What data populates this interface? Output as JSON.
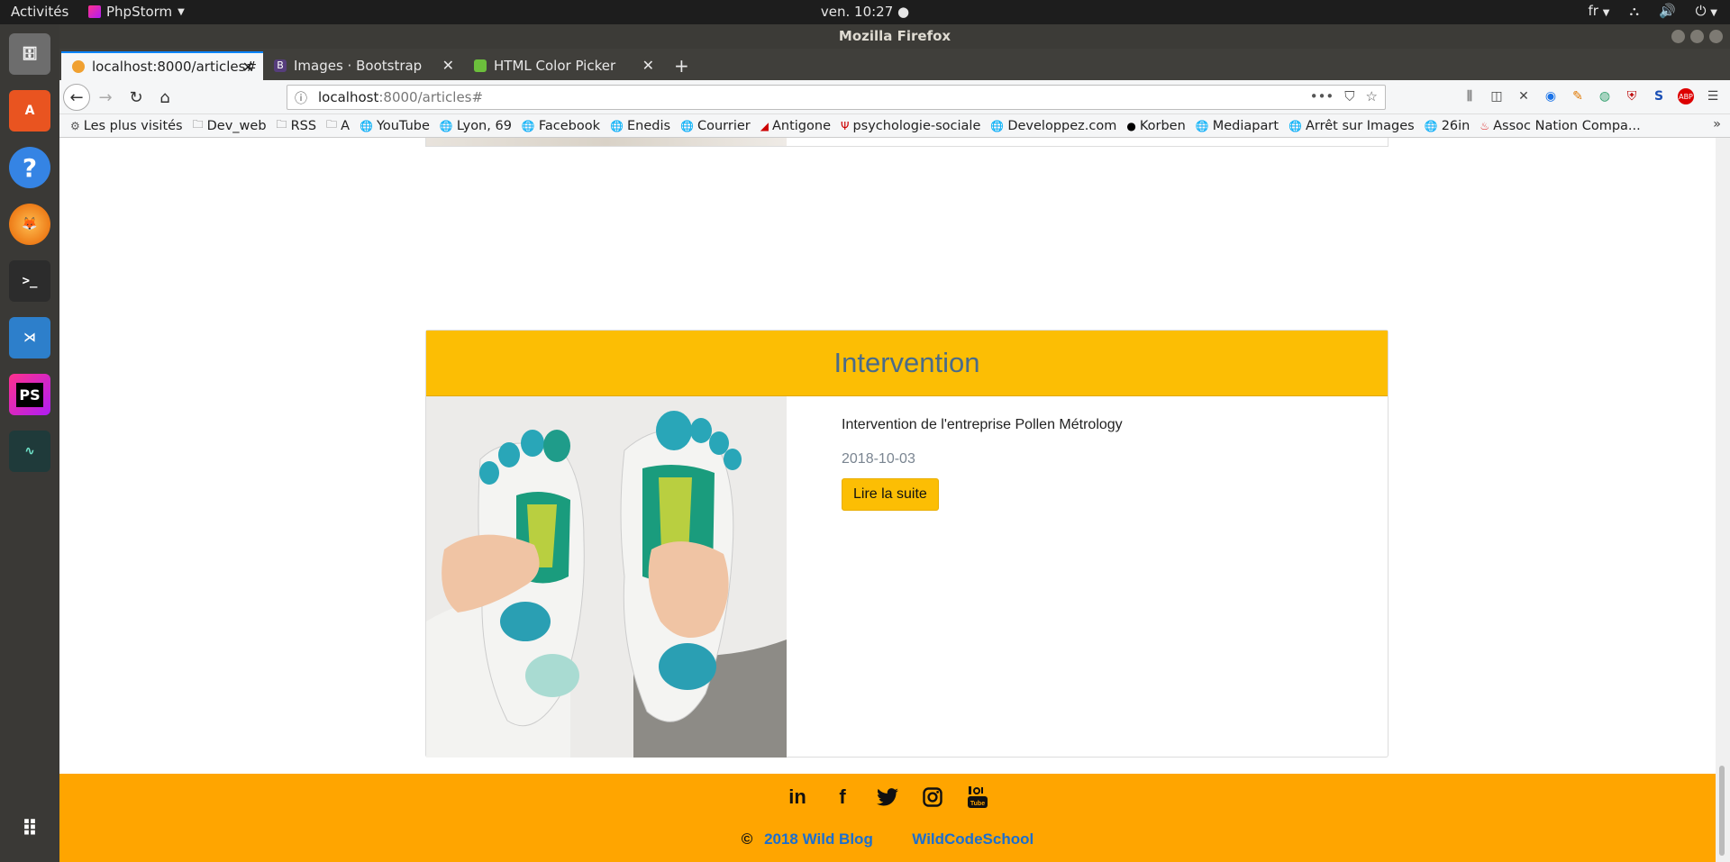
{
  "topbar": {
    "activities": "Activités",
    "app_name": "PhpStorm",
    "clock": "ven. 10:27 ●",
    "lang": "fr"
  },
  "window": {
    "title": "Mozilla Firefox"
  },
  "tabs": [
    {
      "label": "localhost:8000/articles#",
      "favicon_color": "#f0a030",
      "active": true
    },
    {
      "label": "Images · Bootstrap",
      "favicon_color": "#563d7c",
      "favicon_letter": "B",
      "active": false
    },
    {
      "label": "HTML Color Picker",
      "favicon_color": "#6cbf3c",
      "active": false
    }
  ],
  "navbar": {
    "url_host": "localhost",
    "url_rest": ":8000/articles#"
  },
  "bookmarks": [
    {
      "label": "Les plus visités",
      "icon": "gear-icon"
    },
    {
      "label": "Dev_web",
      "icon": "folder-icon"
    },
    {
      "label": "RSS",
      "icon": "folder-icon"
    },
    {
      "label": "A",
      "icon": "folder-icon"
    },
    {
      "label": "YouTube",
      "icon": "globe-icon"
    },
    {
      "label": "Lyon, 69",
      "icon": "globe-icon"
    },
    {
      "label": "Facebook",
      "icon": "globe-icon"
    },
    {
      "label": "Enedis",
      "icon": "globe-icon"
    },
    {
      "label": "Courrier",
      "icon": "globe-icon"
    },
    {
      "label": "Antigone",
      "icon": "antigone-icon"
    },
    {
      "label": "psychologie-sociale",
      "icon": "psi-icon"
    },
    {
      "label": "Developpez.com",
      "icon": "globe-icon"
    },
    {
      "label": "Korben",
      "icon": "korben-icon"
    },
    {
      "label": "Mediapart",
      "icon": "globe-icon"
    },
    {
      "label": "Arrêt sur Images",
      "icon": "globe-icon"
    },
    {
      "label": "26in",
      "icon": "globe-icon"
    },
    {
      "label": "Assoc Nation Compa...",
      "icon": "flame-icon"
    }
  ],
  "article": {
    "title": "Intervention",
    "excerpt": "Intervention de l'entreprise Pollen Métrology",
    "date": "2018-10-03",
    "read_more": "Lire la suite"
  },
  "footer": {
    "social": [
      "linkedin-icon",
      "facebook-icon",
      "twitter-icon",
      "instagram-icon",
      "youtube-icon"
    ],
    "copyright_symbol": "©",
    "copyright_text": "2018 Wild Blog",
    "school": "WildCodeSchool"
  },
  "colors": {
    "accent_yellow": "#fcbe04",
    "footer_orange": "#ffa500",
    "title_blue": "#4a6b8a",
    "link_blue": "#1a6fd1"
  }
}
